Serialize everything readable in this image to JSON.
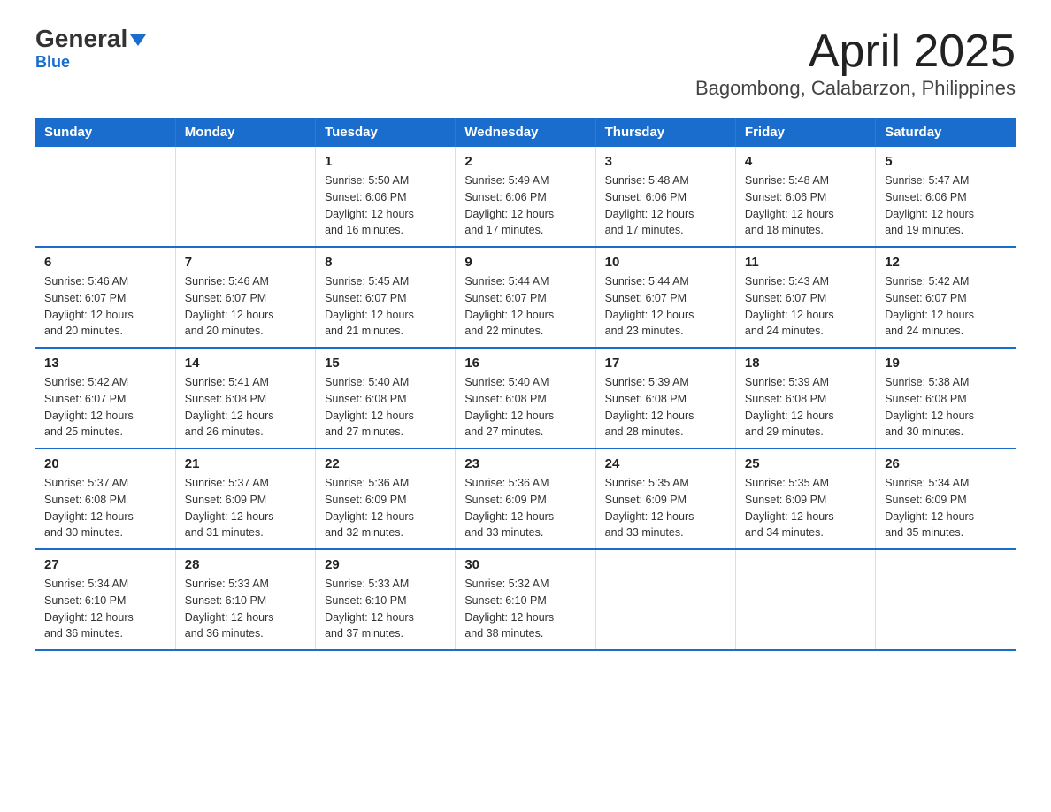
{
  "logo": {
    "text_general": "General",
    "triangle": "▲",
    "text_blue": "Blue"
  },
  "title": "April 2025",
  "subtitle": "Bagombong, Calabarzon, Philippines",
  "days_of_week": [
    "Sunday",
    "Monday",
    "Tuesday",
    "Wednesday",
    "Thursday",
    "Friday",
    "Saturday"
  ],
  "weeks": [
    [
      {
        "day": "",
        "info": ""
      },
      {
        "day": "",
        "info": ""
      },
      {
        "day": "1",
        "info": "Sunrise: 5:50 AM\nSunset: 6:06 PM\nDaylight: 12 hours\nand 16 minutes."
      },
      {
        "day": "2",
        "info": "Sunrise: 5:49 AM\nSunset: 6:06 PM\nDaylight: 12 hours\nand 17 minutes."
      },
      {
        "day": "3",
        "info": "Sunrise: 5:48 AM\nSunset: 6:06 PM\nDaylight: 12 hours\nand 17 minutes."
      },
      {
        "day": "4",
        "info": "Sunrise: 5:48 AM\nSunset: 6:06 PM\nDaylight: 12 hours\nand 18 minutes."
      },
      {
        "day": "5",
        "info": "Sunrise: 5:47 AM\nSunset: 6:06 PM\nDaylight: 12 hours\nand 19 minutes."
      }
    ],
    [
      {
        "day": "6",
        "info": "Sunrise: 5:46 AM\nSunset: 6:07 PM\nDaylight: 12 hours\nand 20 minutes."
      },
      {
        "day": "7",
        "info": "Sunrise: 5:46 AM\nSunset: 6:07 PM\nDaylight: 12 hours\nand 20 minutes."
      },
      {
        "day": "8",
        "info": "Sunrise: 5:45 AM\nSunset: 6:07 PM\nDaylight: 12 hours\nand 21 minutes."
      },
      {
        "day": "9",
        "info": "Sunrise: 5:44 AM\nSunset: 6:07 PM\nDaylight: 12 hours\nand 22 minutes."
      },
      {
        "day": "10",
        "info": "Sunrise: 5:44 AM\nSunset: 6:07 PM\nDaylight: 12 hours\nand 23 minutes."
      },
      {
        "day": "11",
        "info": "Sunrise: 5:43 AM\nSunset: 6:07 PM\nDaylight: 12 hours\nand 24 minutes."
      },
      {
        "day": "12",
        "info": "Sunrise: 5:42 AM\nSunset: 6:07 PM\nDaylight: 12 hours\nand 24 minutes."
      }
    ],
    [
      {
        "day": "13",
        "info": "Sunrise: 5:42 AM\nSunset: 6:07 PM\nDaylight: 12 hours\nand 25 minutes."
      },
      {
        "day": "14",
        "info": "Sunrise: 5:41 AM\nSunset: 6:08 PM\nDaylight: 12 hours\nand 26 minutes."
      },
      {
        "day": "15",
        "info": "Sunrise: 5:40 AM\nSunset: 6:08 PM\nDaylight: 12 hours\nand 27 minutes."
      },
      {
        "day": "16",
        "info": "Sunrise: 5:40 AM\nSunset: 6:08 PM\nDaylight: 12 hours\nand 27 minutes."
      },
      {
        "day": "17",
        "info": "Sunrise: 5:39 AM\nSunset: 6:08 PM\nDaylight: 12 hours\nand 28 minutes."
      },
      {
        "day": "18",
        "info": "Sunrise: 5:39 AM\nSunset: 6:08 PM\nDaylight: 12 hours\nand 29 minutes."
      },
      {
        "day": "19",
        "info": "Sunrise: 5:38 AM\nSunset: 6:08 PM\nDaylight: 12 hours\nand 30 minutes."
      }
    ],
    [
      {
        "day": "20",
        "info": "Sunrise: 5:37 AM\nSunset: 6:08 PM\nDaylight: 12 hours\nand 30 minutes."
      },
      {
        "day": "21",
        "info": "Sunrise: 5:37 AM\nSunset: 6:09 PM\nDaylight: 12 hours\nand 31 minutes."
      },
      {
        "day": "22",
        "info": "Sunrise: 5:36 AM\nSunset: 6:09 PM\nDaylight: 12 hours\nand 32 minutes."
      },
      {
        "day": "23",
        "info": "Sunrise: 5:36 AM\nSunset: 6:09 PM\nDaylight: 12 hours\nand 33 minutes."
      },
      {
        "day": "24",
        "info": "Sunrise: 5:35 AM\nSunset: 6:09 PM\nDaylight: 12 hours\nand 33 minutes."
      },
      {
        "day": "25",
        "info": "Sunrise: 5:35 AM\nSunset: 6:09 PM\nDaylight: 12 hours\nand 34 minutes."
      },
      {
        "day": "26",
        "info": "Sunrise: 5:34 AM\nSunset: 6:09 PM\nDaylight: 12 hours\nand 35 minutes."
      }
    ],
    [
      {
        "day": "27",
        "info": "Sunrise: 5:34 AM\nSunset: 6:10 PM\nDaylight: 12 hours\nand 36 minutes."
      },
      {
        "day": "28",
        "info": "Sunrise: 5:33 AM\nSunset: 6:10 PM\nDaylight: 12 hours\nand 36 minutes."
      },
      {
        "day": "29",
        "info": "Sunrise: 5:33 AM\nSunset: 6:10 PM\nDaylight: 12 hours\nand 37 minutes."
      },
      {
        "day": "30",
        "info": "Sunrise: 5:32 AM\nSunset: 6:10 PM\nDaylight: 12 hours\nand 38 minutes."
      },
      {
        "day": "",
        "info": ""
      },
      {
        "day": "",
        "info": ""
      },
      {
        "day": "",
        "info": ""
      }
    ]
  ]
}
